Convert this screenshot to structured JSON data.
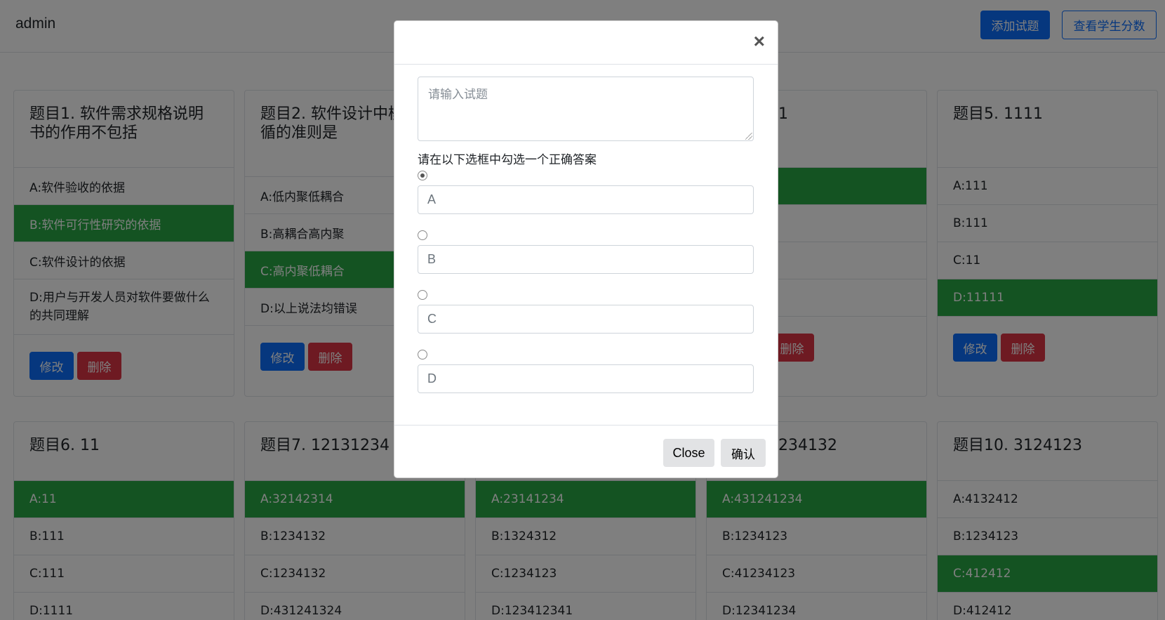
{
  "navbar": {
    "brand": "admin",
    "add_question_label": "添加试题",
    "view_scores_label": "查看学生分数"
  },
  "cards": [
    {
      "title": "题目1. 软件需求规格说明书的作用不包括",
      "options": [
        "A:软件验收的依据",
        "B:软件可行性研究的依据",
        "C:软件设计的依据",
        "D:用户与开发人员对软件要做什么的共同理解"
      ],
      "correct_option": "B",
      "edit_label": "修改",
      "delete_label": "删除"
    },
    {
      "title": "题目2. 软件设计中模应遵循的准则是",
      "options": [
        "A:低内聚低耦合",
        "B:高耦合高内聚",
        "C:高内聚低耦合",
        "D:以上说法均错误"
      ],
      "correct_option": "C",
      "edit_label": "修改",
      "delete_label": "删除"
    },
    {
      "title": "1",
      "options": [],
      "correct_option": "A",
      "edit_label": "修改",
      "delete_label": "删除"
    },
    {
      "title": "题目5. 1111",
      "options": [
        "A:111",
        "B:111",
        "C:11",
        "D:11111"
      ],
      "correct_option": "D",
      "edit_label": "修改",
      "delete_label": "删除"
    },
    {
      "title": "题目6. 11",
      "options": [
        "A:11",
        "B:111",
        "C:111",
        "D:1111"
      ],
      "correct_option": "A"
    },
    {
      "title": "题目7. 12131234",
      "options": [
        "A:32142314",
        "B:1234132",
        "C:1234132",
        "D:431241324"
      ],
      "correct_option": "A"
    },
    {
      "title": "",
      "options": [
        "A:23141234",
        "B:1324312",
        "C:1234123",
        "D:123412341"
      ],
      "correct_option": "A"
    },
    {
      "title": "234132",
      "options": [
        "A:431241234",
        "B:1234123",
        "C:41234123",
        "D:12341234"
      ],
      "correct_option": "A"
    },
    {
      "title": "题目10. 3124123",
      "options": [
        "A:4132412",
        "B:1234123",
        "C:412412",
        "D:412412"
      ],
      "correct_option": "C"
    }
  ],
  "modal": {
    "close_symbol": "×",
    "question_placeholder": "请输入试题",
    "hint": "请在以下选框中勾选一个正确答案",
    "answers": [
      {
        "placeholder": "A",
        "checked": true
      },
      {
        "placeholder": "B",
        "checked": false
      },
      {
        "placeholder": "C",
        "checked": false
      },
      {
        "placeholder": "D",
        "checked": false
      }
    ],
    "close_label": "Close",
    "confirm_label": "确认"
  },
  "colors": {
    "primary": "#0d6efd",
    "danger": "#dc3545",
    "correct": "#28a745"
  }
}
